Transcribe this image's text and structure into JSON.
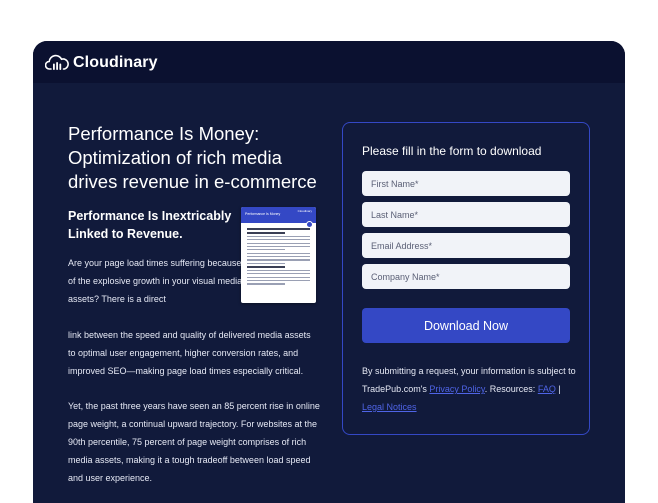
{
  "brand": {
    "name": "Cloudinary"
  },
  "hero": {
    "title": "Performance Is Money: Optimization of rich media drives revenue in e-commerce",
    "subtitle": "Performance Is Inextricably Linked to Revenue.",
    "paragraph1_part1": "Are your page load times suffering because of the explosive growth in your visual media assets? There is a direct",
    "paragraph1_part2": "link between the speed and quality of delivered media assets to optimal user engagement, higher conversion rates, and improved SEO—making page load times especially critical.",
    "paragraph2": "Yet, the past three years have seen an 85 percent rise in online page weight, a continual upward trajectory. For websites at the 90th percentile, 75 percent of page weight comprises of rich media assets, making it a tough tradeoff between load speed and user experience."
  },
  "thumbnail": {
    "title": "Performance Is Money",
    "logo": "Cloudinary"
  },
  "form": {
    "heading": "Please fill in the form to download",
    "first_name_placeholder": "First Name*",
    "last_name_placeholder": "Last Name*",
    "email_placeholder": "Email Address*",
    "company_placeholder": "Company Name*",
    "submit_label": "Download Now",
    "legal_text_1": "By submitting a request, your information is subject to TradePub.com's ",
    "privacy_link": "Privacy Policy",
    "legal_text_2": ". Resources: ",
    "faq_link": "FAQ",
    "legal_text_3": " | ",
    "legal_link": "Legal Notices"
  },
  "colors": {
    "background": "#111a3b",
    "header": "#0b1130",
    "accent": "#3448c5",
    "link": "#4f64e6"
  }
}
